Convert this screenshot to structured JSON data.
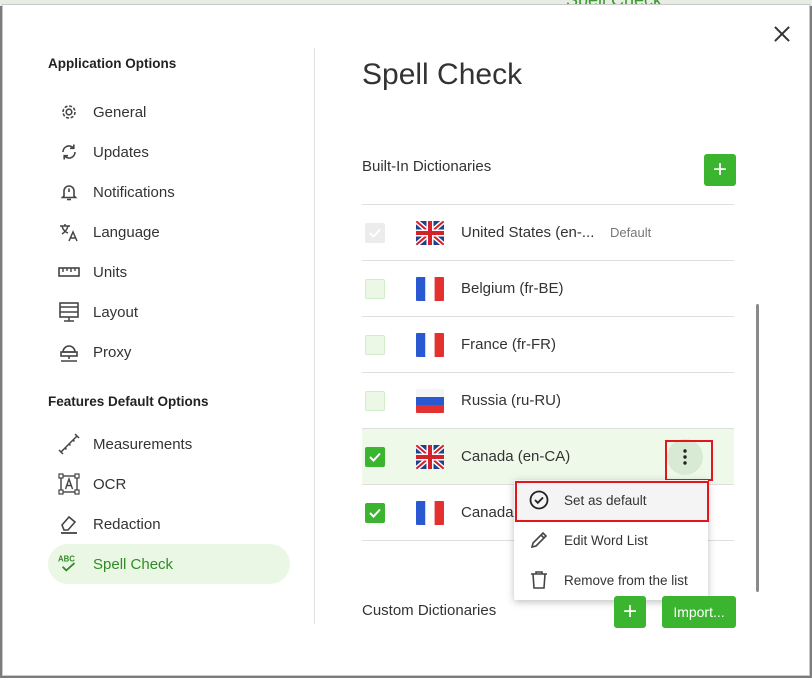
{
  "background": {
    "hint": "Spell Check"
  },
  "sidebar": {
    "app_title": "Application Options",
    "app_items": [
      {
        "label": "General",
        "icon": "gear-icon"
      },
      {
        "label": "Updates",
        "icon": "sync-icon"
      },
      {
        "label": "Notifications",
        "icon": "bell-icon"
      },
      {
        "label": "Language",
        "icon": "translate-icon"
      },
      {
        "label": "Units",
        "icon": "ruler-icon"
      },
      {
        "label": "Layout",
        "icon": "layout-icon"
      },
      {
        "label": "Proxy",
        "icon": "proxy-icon"
      }
    ],
    "features_title": "Features Default Options",
    "feature_items": [
      {
        "label": "Measurements",
        "icon": "measure-icon"
      },
      {
        "label": "OCR",
        "icon": "ocr-icon"
      },
      {
        "label": "Redaction",
        "icon": "eraser-icon"
      },
      {
        "label": "Spell Check",
        "icon": "spellcheck-icon",
        "active": true
      }
    ]
  },
  "main": {
    "title": "Spell Check",
    "builtin_label": "Built-In Dictionaries",
    "add_label": "+",
    "dictionaries": [
      {
        "name": "United States (en-...",
        "badge": "Default",
        "flag": "uk",
        "checked": true,
        "disabled": true
      },
      {
        "name": "Belgium (fr-BE)",
        "flag": "fr",
        "checked": false
      },
      {
        "name": "France (fr-FR)",
        "flag": "fr",
        "checked": false
      },
      {
        "name": "Russia (ru-RU)",
        "flag": "ru",
        "checked": false
      },
      {
        "name": "Canada (en-CA)",
        "flag": "uk",
        "checked": true,
        "selected": true
      },
      {
        "name": "Canada",
        "flag": "fr",
        "checked": true
      }
    ],
    "custom_label": "Custom Dictionaries",
    "custom_add_label": "+",
    "import_label": "Import..."
  },
  "context_menu": {
    "items": [
      {
        "label": "Set as default",
        "icon": "check-circle-icon"
      },
      {
        "label": "Edit Word List",
        "icon": "pencil-icon"
      },
      {
        "label": "Remove from the list",
        "icon": "trash-icon"
      }
    ]
  },
  "colors": {
    "accent": "#3bb52f",
    "active_bg": "#eaf7e5",
    "highlight": "#e3161d"
  }
}
